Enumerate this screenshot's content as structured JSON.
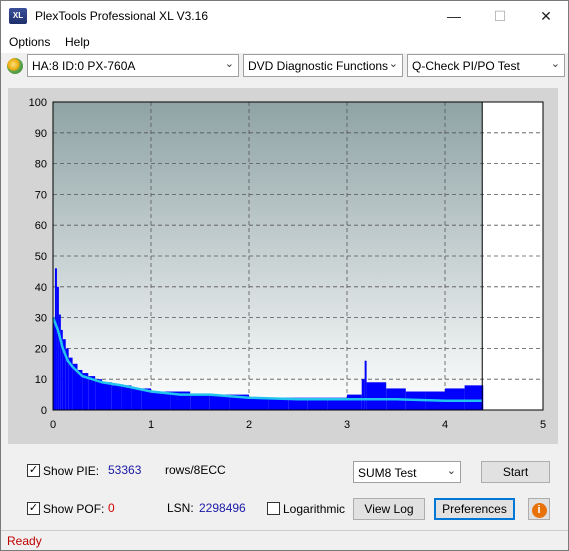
{
  "window": {
    "title": "PlexTools Professional XL V3.16",
    "icon": "XL"
  },
  "menu": {
    "options": "Options",
    "help": "Help"
  },
  "toolbar": {
    "drive": "HA:8 ID:0  PX-760A",
    "function": "DVD Diagnostic Functions",
    "test": "Q-Check PI/PO Test"
  },
  "chart_data": {
    "type": "bar",
    "title": "",
    "xlabel": "",
    "ylabel": "",
    "xlim": [
      0,
      5
    ],
    "ylim": [
      0,
      100
    ],
    "x_ticks": [
      "0",
      "1",
      "2",
      "3",
      "4",
      "5"
    ],
    "y_ticks": [
      "0",
      "10",
      "20",
      "30",
      "40",
      "50",
      "60",
      "70",
      "80",
      "90",
      "100"
    ],
    "grid": true,
    "data_end_x": 4.38,
    "series": [
      {
        "kind": "bars",
        "color": "#0000ff",
        "x": [
          0.0,
          0.02,
          0.04,
          0.06,
          0.08,
          0.1,
          0.13,
          0.16,
          0.2,
          0.25,
          0.3,
          0.36,
          0.43,
          0.5,
          0.6,
          0.7,
          0.8,
          0.9,
          1.0,
          1.2,
          1.4,
          1.6,
          1.8,
          2.0,
          2.2,
          2.4,
          2.6,
          2.8,
          3.0,
          3.15,
          3.18,
          3.2,
          3.4,
          3.6,
          3.8,
          4.0,
          4.2,
          4.38
        ],
        "values": [
          30,
          46,
          40,
          31,
          26,
          23,
          20,
          17,
          15,
          13,
          12,
          11,
          10,
          9,
          8,
          8,
          7,
          7,
          6,
          6,
          5,
          5,
          5,
          4,
          4,
          4,
          4,
          4,
          5,
          10,
          16,
          9,
          7,
          6,
          6,
          7,
          8,
          8
        ]
      },
      {
        "kind": "line",
        "color": "#22c4ee",
        "x": [
          0.0,
          0.05,
          0.1,
          0.15,
          0.2,
          0.3,
          0.4,
          0.5,
          0.7,
          1.0,
          1.3,
          1.6,
          2.0,
          2.5,
          3.0,
          3.5,
          4.0,
          4.38
        ],
        "values": [
          30,
          26,
          20,
          16,
          14,
          11,
          10,
          9,
          8,
          6,
          5,
          5,
          4,
          3.5,
          3.5,
          3.5,
          3,
          3
        ]
      }
    ]
  },
  "controls": {
    "show_pie_label": "Show PIE:",
    "pie_value": "53363",
    "pie_unit": "rows/8ECC",
    "show_pof_label": "Show POF:",
    "pof_value": "0",
    "lsn_label": "LSN:",
    "lsn_value": "2298496",
    "logarithmic_label": "Logarithmic",
    "test_mode": "SUM8 Test",
    "start": "Start",
    "view_log": "View Log",
    "preferences": "Preferences",
    "info_icon": "i"
  },
  "colors": {
    "bar": "#0000ff",
    "trend": "#22c4ee",
    "accent": "#e8710a"
  },
  "status": {
    "text": "Ready"
  }
}
